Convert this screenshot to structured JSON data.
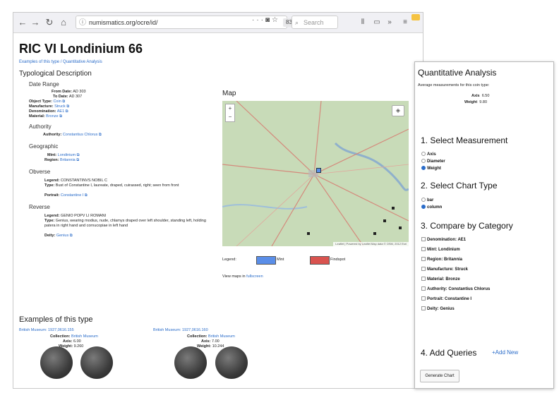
{
  "browser": {
    "url": "numismatics.org/ocre/id/",
    "zoom": "83%",
    "search_placeholder": "Search",
    "nav_icons": [
      "back-icon",
      "forward-icon",
      "reload-icon",
      "home-icon"
    ]
  },
  "page": {
    "title": "RIC VI Londinium 66",
    "subtitle_link": "Examples of this type / Quantitative Analysis",
    "typology": {
      "heading": "Typological Description",
      "date_range_heading": "Date Range",
      "fields": [
        {
          "label": "From Date:",
          "value": "AD 303"
        },
        {
          "label": "To Date:",
          "value": "AD 307"
        },
        {
          "label": "Object Type:",
          "value": "Coin"
        },
        {
          "label": "Manufacture:",
          "value": "Struck"
        },
        {
          "label": "Denomination:",
          "value": "AE1"
        },
        {
          "label": "Material:",
          "value": "Bronze"
        }
      ],
      "authority_heading": "Authority",
      "authority": {
        "label": "Authority:",
        "value": "Constantius Chlorus"
      },
      "geographic_heading": "Geographic",
      "mint": {
        "label": "Mint:",
        "value": "Londinium"
      },
      "region": {
        "label": "Region:",
        "value": "Britannia"
      },
      "obverse_heading": "Obverse",
      "obverse_legend": {
        "label": "Legend:",
        "value": "CONSTANTINVS NOBIL C"
      },
      "obverse_type": {
        "label": "Type:",
        "value": "Bust of Constantine I, laureate, draped, cuirassed, right; seen from front"
      },
      "obverse_portrait": {
        "label": "Portrait:",
        "value": "Constantine I"
      },
      "reverse_heading": "Reverse",
      "reverse_legend": {
        "label": "Legend:",
        "value": "GENIO POPV LI ROMANI"
      },
      "reverse_type": {
        "label": "Type:",
        "value": "Genius, wearing modius, nude, chlamys draped over left shoulder, standing left, holding patera in right hand and cornucopiae in left hand"
      },
      "reverse_deity": {
        "label": "Deity:",
        "value": "Genius"
      }
    },
    "map": {
      "heading": "Map",
      "zoom_in": "+",
      "zoom_out": "−",
      "attribution": "Leaflet | Powered by Leaflet Map data © OSM, 2012 Esri",
      "legend_label": "Legend:",
      "legend_mint": "Mint",
      "legend_findspot": "Findspot",
      "view_maps_prefix": "View maps in",
      "view_maps_link": "fullscreen",
      "mint_color": "#5a8ee8",
      "findspot_color": "#d9534f"
    },
    "examples": {
      "heading": "Examples of this type",
      "items": [
        {
          "link": "British Museum: 1927,0616.155",
          "collection_label": "Collection:",
          "collection": "British Museum",
          "axis_label": "Axis:",
          "axis": "6.00",
          "weight_label": "Weight:",
          "weight": "9.260"
        },
        {
          "link": "British Museum: 1927,0616.160",
          "collection_label": "Collection:",
          "collection": "British Museum",
          "axis_label": "Axis:",
          "axis": "7.00",
          "weight_label": "Weight:",
          "weight": "10.244"
        }
      ]
    }
  },
  "panel": {
    "title": "Quantitative Analysis",
    "intro": "Average measurements for this coin type:",
    "axis_label": "Axis",
    "axis_value": "6.50",
    "weight_label": "Weight",
    "weight_value": "9.80",
    "step1": "1. Select Measurement",
    "measurements": [
      {
        "label": "Axis",
        "selected": false
      },
      {
        "label": "Diameter",
        "selected": false
      },
      {
        "label": "Weight",
        "selected": true
      }
    ],
    "step2": "2. Select Chart Type",
    "chart_types": [
      {
        "label": "bar",
        "selected": false
      },
      {
        "label": "column",
        "selected": true
      }
    ],
    "step3": "3. Compare by Category",
    "categories": [
      "Denomination: AE1",
      "Mint: Londinium",
      "Region: Britannia",
      "Manufacture: Struck",
      "Material: Bronze",
      "Authority: Constantius Chlorus",
      "Portrait: Constantine I",
      "Deity: Genius"
    ],
    "step4": "4. Add Queries",
    "add_new": "+Add New",
    "generate_button": "Generate Chart"
  }
}
